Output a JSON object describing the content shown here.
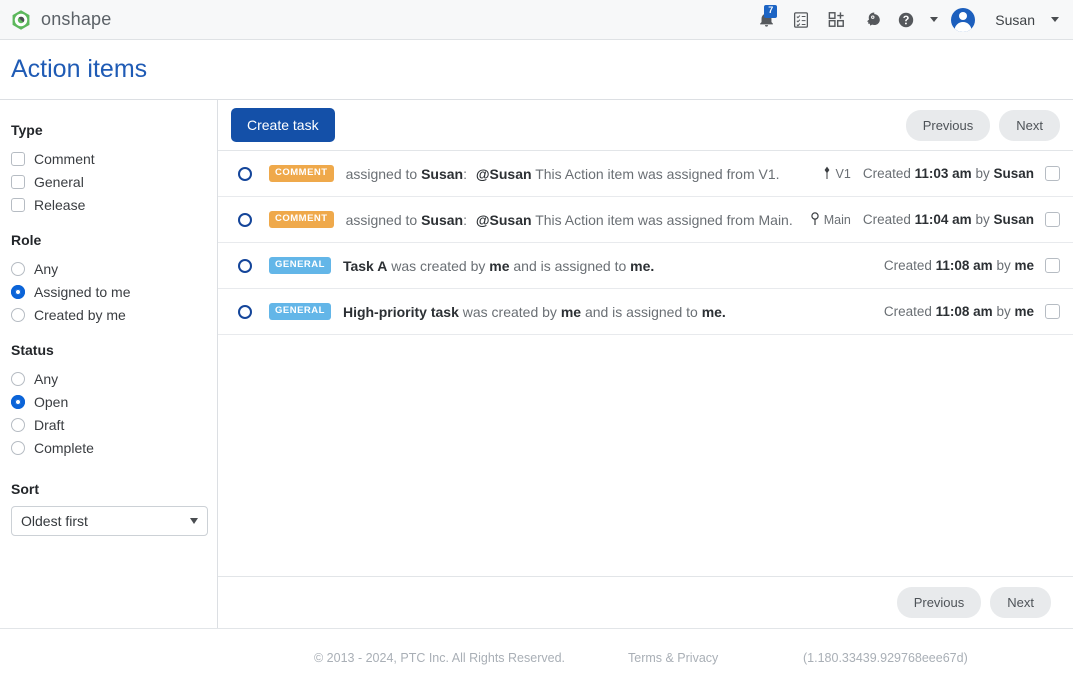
{
  "topbar": {
    "brand_name": "onshape",
    "brand_logo_icon": "onshape-logo-icon",
    "notifications_icon": "bell-icon",
    "notifications_count": "7",
    "tasks_icon": "task-list-icon",
    "apps_icon": "apps-add-icon",
    "learning_icon": "learning-brain-icon",
    "help_icon": "help-question-icon",
    "help_caret_icon": "chevron-down-icon",
    "avatar_icon": "user-avatar-icon",
    "user_name": "Susan",
    "user_caret_icon": "chevron-down-icon"
  },
  "page": {
    "title": "Action items"
  },
  "sidebar": {
    "groups": [
      {
        "title": "Type",
        "control": "checkbox",
        "options": [
          {
            "label": "Comment",
            "checked": false
          },
          {
            "label": "General",
            "checked": false
          },
          {
            "label": "Release",
            "checked": false
          }
        ]
      },
      {
        "title": "Role",
        "control": "radio",
        "options": [
          {
            "label": "Any",
            "checked": false
          },
          {
            "label": "Assigned to me",
            "checked": true
          },
          {
            "label": "Created by me",
            "checked": false
          }
        ]
      },
      {
        "title": "Status",
        "control": "radio",
        "options": [
          {
            "label": "Any",
            "checked": false
          },
          {
            "label": "Open",
            "checked": true
          },
          {
            "label": "Draft",
            "checked": false
          },
          {
            "label": "Complete",
            "checked": false
          }
        ]
      }
    ],
    "sort": {
      "title": "Sort",
      "value": "Oldest first",
      "caret_icon": "chevron-down-icon"
    }
  },
  "toolbar": {
    "create_task_label": "Create task",
    "previous_label": "Previous",
    "next_label": "Next"
  },
  "tasks": [
    {
      "status_icon": "open-circle-icon",
      "badge": "COMMENT",
      "badge_type": "comment",
      "prefix": "assigned to",
      "assignee": "Susan",
      "colon": ":",
      "mention": "@Susan",
      "description": "This Action item was assigned from V1.",
      "scope_icon": "version-icon",
      "scope_label": "V1",
      "created_prefix": "Created",
      "created_time": "11:03 am",
      "created_by_prefix": "by",
      "created_by": "Susan",
      "checkbox_icon": "row-checkbox"
    },
    {
      "status_icon": "open-circle-icon",
      "badge": "COMMENT",
      "badge_type": "comment",
      "prefix": "assigned to",
      "assignee": "Susan",
      "colon": ":",
      "mention": "@Susan",
      "description": "This Action item was assigned from Main.",
      "scope_icon": "workspace-branch-icon",
      "scope_label": "Main",
      "created_prefix": "Created",
      "created_time": "11:04 am",
      "created_by_prefix": "by",
      "created_by": "Susan",
      "checkbox_icon": "row-checkbox"
    },
    {
      "status_icon": "open-circle-icon",
      "badge": "GENERAL",
      "badge_type": "general",
      "title": "Task A",
      "description": "was created by",
      "actor1": "me",
      "middle": "and is assigned to",
      "actor2": "me",
      "end": ".",
      "scope_icon": "",
      "scope_label": "",
      "created_prefix": "Created",
      "created_time": "11:08 am",
      "created_by_prefix": "by",
      "created_by": "me",
      "checkbox_icon": "row-checkbox"
    },
    {
      "status_icon": "open-circle-icon",
      "badge": "GENERAL",
      "badge_type": "general",
      "title": "High-priority task",
      "description": "was created by",
      "actor1": "me",
      "middle": "and is assigned to",
      "actor2": "me",
      "end": ".",
      "scope_icon": "",
      "scope_label": "",
      "created_prefix": "Created",
      "created_time": "11:08 am",
      "created_by_prefix": "by",
      "created_by": "me",
      "checkbox_icon": "row-checkbox"
    }
  ],
  "bottom_pager": {
    "previous_label": "Previous",
    "next_label": "Next"
  },
  "footer": {
    "copyright": "© 2013 - 2024, PTC Inc. All Rights Reserved.",
    "terms": "Terms & Privacy",
    "version": "(1.180.33439.929768eee67d)"
  },
  "colors": {
    "brand_green": "#5cb85c",
    "accent_blue": "#1450a8",
    "title_blue": "#1f5bb5",
    "badge_comment": "#efa94b",
    "badge_general": "#63b6e8",
    "status_ring": "#14459a"
  }
}
